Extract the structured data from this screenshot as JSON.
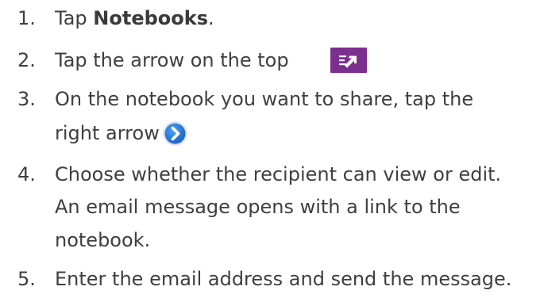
{
  "steps": [
    {
      "number": "1.",
      "lines": [
        {
          "prefix": "Tap ",
          "bold": "Notebooks",
          "suffix": "."
        }
      ]
    },
    {
      "number": "2.",
      "lines": [
        "Tap the arrow on the top"
      ],
      "icon": "share-arrow-icon"
    },
    {
      "number": "3.",
      "lines": [
        "On the notebook you want to share, tap the",
        "right arrow"
      ],
      "icon": "right-arrow-circle-icon"
    },
    {
      "number": "4.",
      "lines": [
        "Choose whether the recipient can view or edit.",
        "An email message opens with a link to the",
        "notebook."
      ]
    },
    {
      "number": "5.",
      "lines": [
        "Enter the email address and send the message."
      ]
    }
  ],
  "colors": {
    "text": "#3f3f3f",
    "share_icon_bg": "#7b2f8e",
    "arrow_circle_blue": "#1e73d8"
  }
}
